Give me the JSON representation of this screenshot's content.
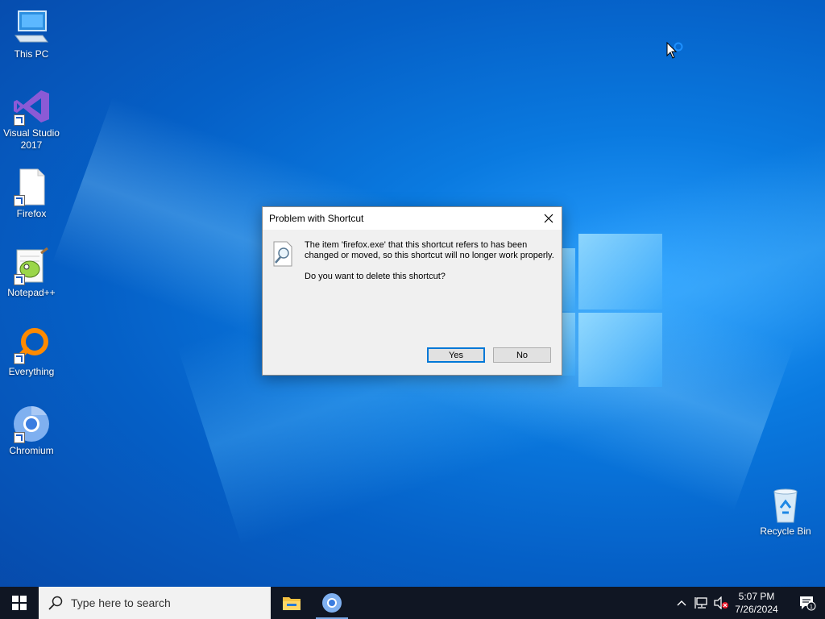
{
  "desktop": {
    "icons": [
      {
        "label": "This PC"
      },
      {
        "label": "Visual Studio 2017"
      },
      {
        "label": "Firefox"
      },
      {
        "label": "Notepad++"
      },
      {
        "label": "Everything"
      },
      {
        "label": "Chromium"
      },
      {
        "label": "Recycle Bin"
      }
    ]
  },
  "dialog": {
    "title": "Problem with Shortcut",
    "message": "The item 'firefox.exe' that this shortcut refers to has been changed or moved, so this shortcut will no longer work properly.",
    "question": "Do you want to delete this shortcut?",
    "yes_label": "Yes",
    "no_label": "No"
  },
  "taskbar": {
    "search_placeholder": "Type here to search",
    "time": "5:07 PM",
    "date": "7/26/2024",
    "notification_count": "1"
  },
  "colors": {
    "accent": "#0078d7",
    "taskbar": "#101623"
  }
}
